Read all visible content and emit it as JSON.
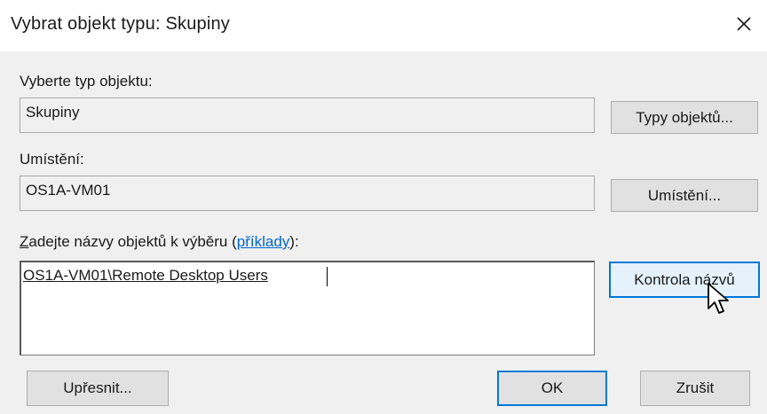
{
  "window": {
    "title": "Vybrat objekt typu: Skupiny",
    "close_icon": "close-icon"
  },
  "object_type": {
    "label": "Vyberte typ objektu:",
    "value": "Skupiny",
    "button_label": "Typy objektů..."
  },
  "location": {
    "label": "Umístění:",
    "value": "OS1A-VM01",
    "button_label": "Umístění..."
  },
  "names": {
    "label_first_char": "Z",
    "label_rest": "adejte názvy objektů k výběru (",
    "link_text": "příklady",
    "label_end": "):",
    "value": "OS1A-VM01\\Remote Desktop Users",
    "check_button_label": "Kontrola názvů"
  },
  "footer": {
    "advanced_label": "Upřesnit...",
    "ok_label": "OK",
    "cancel_label": "Zrušit"
  },
  "cursor_icon": "mouse-pointer-icon",
  "accent_color": "#0078d7"
}
